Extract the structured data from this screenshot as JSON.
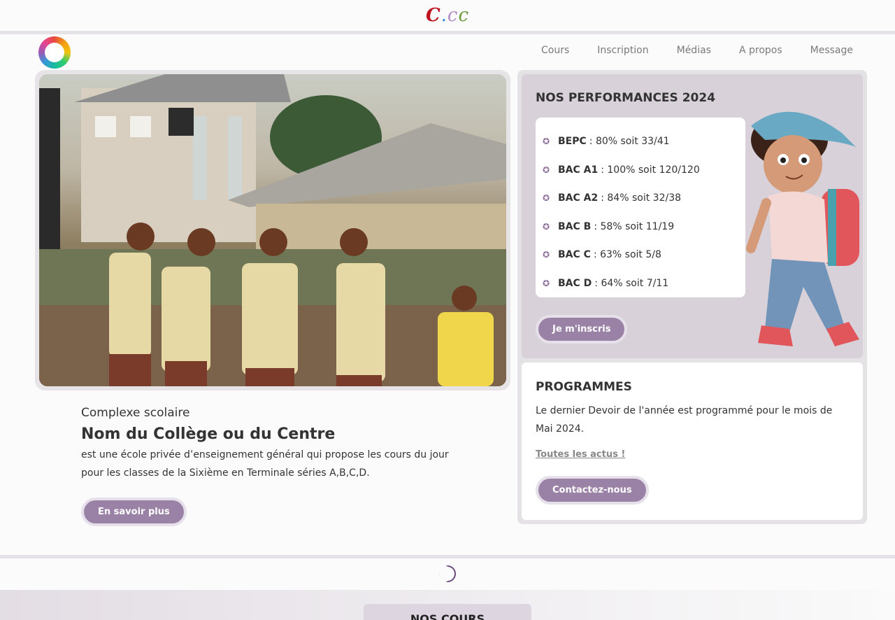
{
  "brand": {
    "part1": "C",
    "dot": ".",
    "part2": "c",
    "part3": "c"
  },
  "nav": {
    "items": [
      {
        "label": "Cours"
      },
      {
        "label": "Inscription"
      },
      {
        "label": "Médias"
      },
      {
        "label": "A propos"
      },
      {
        "label": "Message"
      }
    ]
  },
  "hero": {
    "kicker": "Complexe scolaire",
    "name": "Nom du Collège ou du Centre",
    "description": "est une école privée d’enseignement général qui propose les cours du jour pour les classes de la Sixième en Terminale séries A,B,C,D.",
    "more_button": "En savoir plus"
  },
  "performances": {
    "title": "NOS PERFORMANCES 2024",
    "items": [
      {
        "label": "BEPC",
        "value": ": 80% soit 33/41"
      },
      {
        "label": "BAC A1",
        "value": ": 100% soit 120/120"
      },
      {
        "label": "BAC A2",
        "value": ": 84% soit 32/38"
      },
      {
        "label": "BAC B",
        "value": ": 58% soit 11/19"
      },
      {
        "label": "BAC C",
        "value": ": 63% soit 5/8"
      },
      {
        "label": "BAC D",
        "value": ": 64% soit 7/11"
      }
    ],
    "join_button": "Je m'inscris"
  },
  "programmes": {
    "title": "PROGRAMMES",
    "text": "Le dernier Devoir de l'année est programmé pour le mois de Mai 2024.",
    "news_link": "Toutes les actus !",
    "contact_button": "Contactez-nous"
  },
  "courses": {
    "title": "NOS COURS"
  },
  "colors": {
    "accent": "#9a81a6",
    "brand_red": "#c1121f",
    "card_bg": "#d8d1da"
  }
}
